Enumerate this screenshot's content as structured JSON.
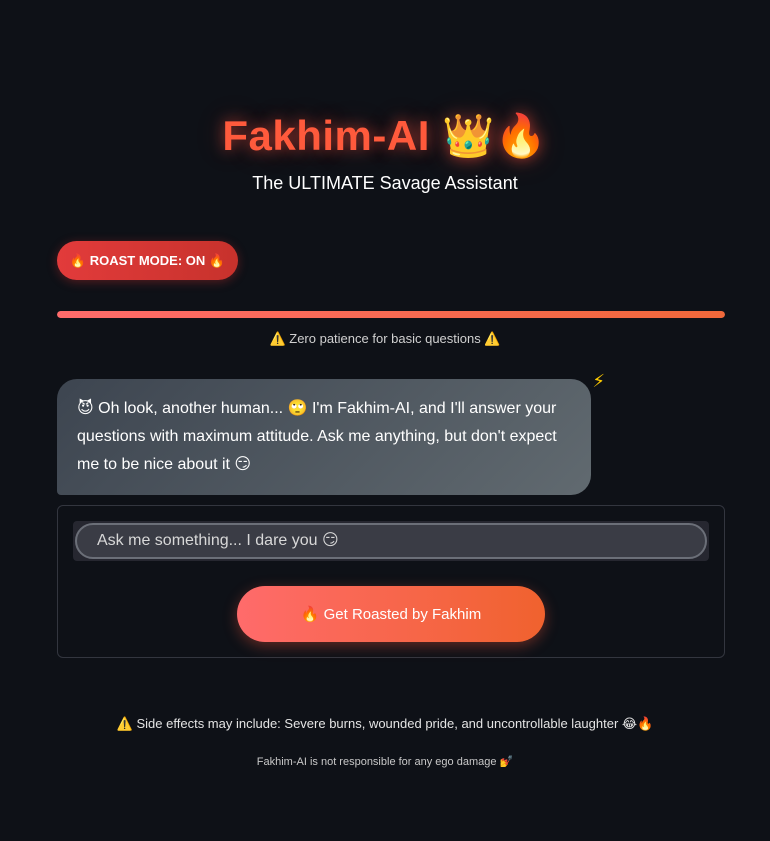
{
  "header": {
    "title": "Fakhim-AI",
    "title_icons": "👑🔥",
    "subtitle": "The ULTIMATE Savage Assistant"
  },
  "badge": {
    "label": "🔥 ROAST MODE: ON 🔥"
  },
  "progress": {
    "value": 1.0
  },
  "notice": {
    "text": "⚠️ Zero patience for basic questions ⚠️"
  },
  "chat": {
    "message": "😈 Oh look, another human... 🙄 I'm Fakhim-AI, and I'll answer your questions with maximum attitude. Ask me anything, but don't expect me to be nice about it 😏",
    "decoration": "⚡"
  },
  "form": {
    "placeholder": "Ask me something... I dare you 😏",
    "submit_label": "🔥 Get Roasted by Fakhim"
  },
  "footer": {
    "warning": "⚠️ Side effects may include: Severe burns, wounded pride, and uncontrollable laughter 😂🔥",
    "disclaimer": "Fakhim-AI is not responsible for any ego damage 💅"
  },
  "colors": {
    "background": "#0e1117",
    "accent": "#ff5a3c",
    "badge": "#e23b3b"
  },
  "icons": {
    "title": [
      "crown-icon",
      "fire-icon"
    ],
    "chat": [
      "devil-icon",
      "eye-roll-icon",
      "smirk-icon",
      "lightning-icon"
    ]
  }
}
